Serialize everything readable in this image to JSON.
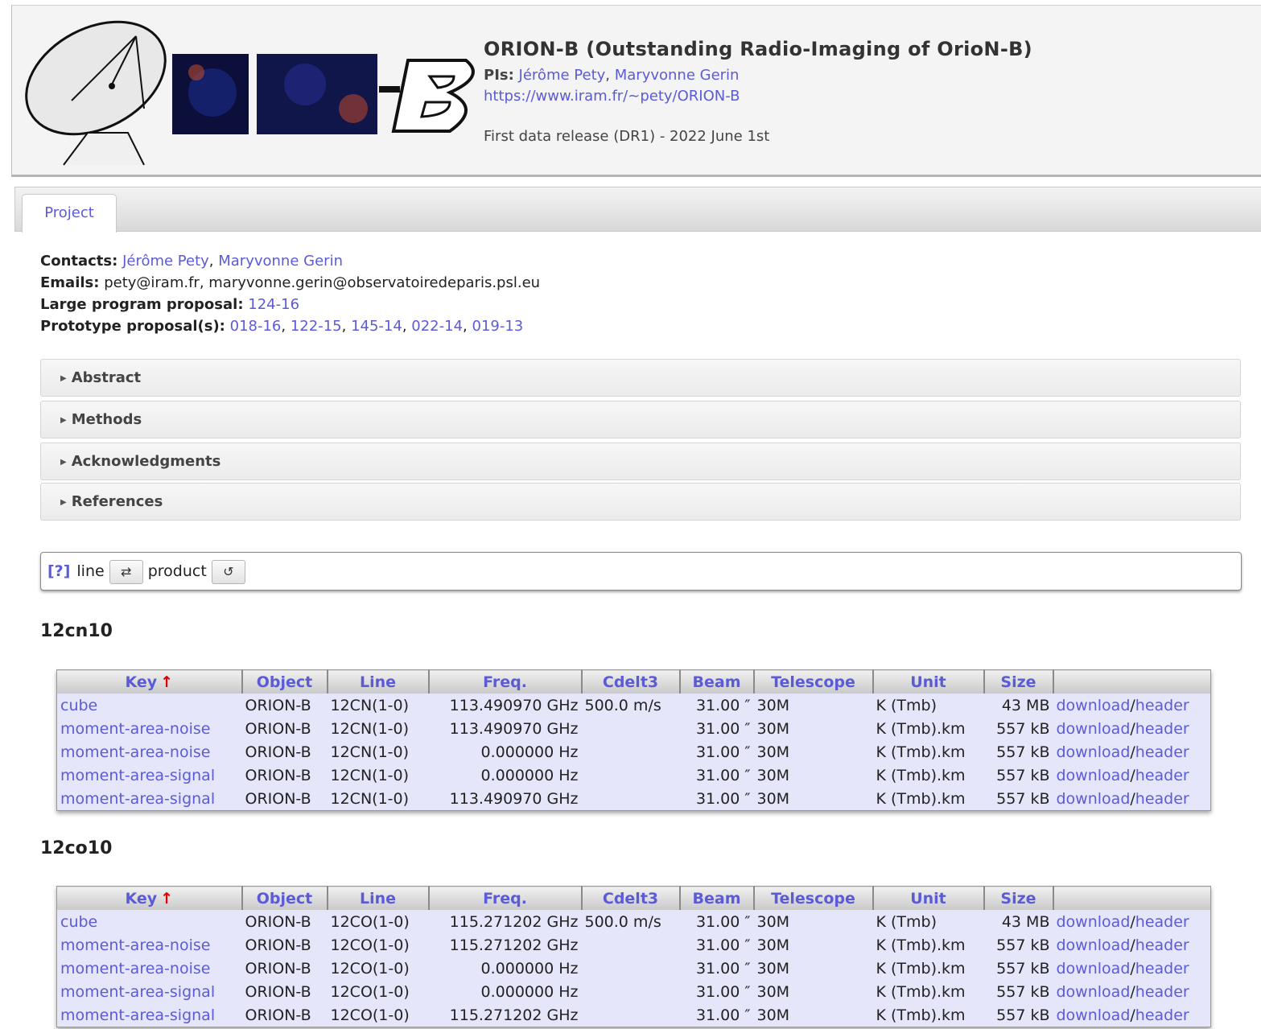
{
  "header": {
    "logo_text": "ORION-B",
    "title": "ORION-B (Outstanding Radio-Imaging of OrioN-B)",
    "pis_label": "PIs:",
    "pis": [
      "Jérôme Pety",
      "Maryvonne Gerin"
    ],
    "url": "https://www.iram.fr/~pety/ORION-B",
    "release": "First data release (DR1) - 2022 June 1st"
  },
  "tabs": [
    {
      "label": "Project"
    }
  ],
  "project": {
    "contacts_label": "Contacts:",
    "contacts": [
      "Jérôme Pety",
      "Maryvonne Gerin"
    ],
    "emails_label": "Emails:",
    "emails": "pety@iram.fr, maryvonne.gerin@observatoiredeparis.psl.eu",
    "large_label": "Large program proposal:",
    "large_program": "124-16",
    "proto_label": "Prototype proposal(s):",
    "prototypes": [
      "018-16",
      "122-15",
      "145-14",
      "022-14",
      "019-13"
    ]
  },
  "accordions": [
    "Abstract",
    "Methods",
    "Acknowledgments",
    "References"
  ],
  "filter": {
    "help": "[?]",
    "label_line": "line",
    "swap_icon": "⇄",
    "label_product": "product",
    "reset_icon": "↺"
  },
  "table_headers": [
    "Key",
    "Object",
    "Line",
    "Freq.",
    "Cdelt3",
    "Beam",
    "Telescope",
    "Unit",
    "Size",
    ""
  ],
  "sort_icon": "↑",
  "sections": [
    {
      "title": "12cn10",
      "rows": [
        {
          "key": "cube",
          "object": "ORION-B",
          "line": "12CN(1-0)",
          "freq": "113.490970 GHz",
          "cdelt3": "500.0 m/s",
          "beam": "31.00 ″",
          "telescope": "30M",
          "unit": "K (Tmb)",
          "size": "43 MB",
          "download": "download",
          "sep": "/",
          "header": "header"
        },
        {
          "key": "moment-area-noise",
          "object": "ORION-B",
          "line": "12CN(1-0)",
          "freq": "113.490970 GHz",
          "cdelt3": "",
          "beam": "31.00 ″",
          "telescope": "30M",
          "unit": "K (Tmb).km",
          "size": "557 kB",
          "download": "download",
          "sep": "/",
          "header": "header"
        },
        {
          "key": "moment-area-noise",
          "object": "ORION-B",
          "line": "12CN(1-0)",
          "freq": "0.000000 Hz",
          "cdelt3": "",
          "beam": "31.00 ″",
          "telescope": "30M",
          "unit": "K (Tmb).km",
          "size": "557 kB",
          "download": "download",
          "sep": "/",
          "header": "header"
        },
        {
          "key": "moment-area-signal",
          "object": "ORION-B",
          "line": "12CN(1-0)",
          "freq": "0.000000 Hz",
          "cdelt3": "",
          "beam": "31.00 ″",
          "telescope": "30M",
          "unit": "K (Tmb).km",
          "size": "557 kB",
          "download": "download",
          "sep": "/",
          "header": "header"
        },
        {
          "key": "moment-area-signal",
          "object": "ORION-B",
          "line": "12CN(1-0)",
          "freq": "113.490970 GHz",
          "cdelt3": "",
          "beam": "31.00 ″",
          "telescope": "30M",
          "unit": "K (Tmb).km",
          "size": "557 kB",
          "download": "download",
          "sep": "/",
          "header": "header"
        }
      ]
    },
    {
      "title": "12co10",
      "rows": [
        {
          "key": "cube",
          "object": "ORION-B",
          "line": "12CO(1-0)",
          "freq": "115.271202 GHz",
          "cdelt3": "500.0 m/s",
          "beam": "31.00 ″",
          "telescope": "30M",
          "unit": "K (Tmb)",
          "size": "43 MB",
          "download": "download",
          "sep": "/",
          "header": "header"
        },
        {
          "key": "moment-area-noise",
          "object": "ORION-B",
          "line": "12CO(1-0)",
          "freq": "115.271202 GHz",
          "cdelt3": "",
          "beam": "31.00 ″",
          "telescope": "30M",
          "unit": "K (Tmb).km",
          "size": "557 kB",
          "download": "download",
          "sep": "/",
          "header": "header"
        },
        {
          "key": "moment-area-noise",
          "object": "ORION-B",
          "line": "12CO(1-0)",
          "freq": "0.000000 Hz",
          "cdelt3": "",
          "beam": "31.00 ″",
          "telescope": "30M",
          "unit": "K (Tmb).km",
          "size": "557 kB",
          "download": "download",
          "sep": "/",
          "header": "header"
        },
        {
          "key": "moment-area-signal",
          "object": "ORION-B",
          "line": "12CO(1-0)",
          "freq": "0.000000 Hz",
          "cdelt3": "",
          "beam": "31.00 ″",
          "telescope": "30M",
          "unit": "K (Tmb).km",
          "size": "557 kB",
          "download": "download",
          "sep": "/",
          "header": "header"
        },
        {
          "key": "moment-area-signal",
          "object": "ORION-B",
          "line": "12CO(1-0)",
          "freq": "115.271202 GHz",
          "cdelt3": "",
          "beam": "31.00 ″",
          "telescope": "30M",
          "unit": "K (Tmb).km",
          "size": "557 kB",
          "download": "download",
          "sep": "/",
          "header": "header"
        }
      ]
    }
  ]
}
